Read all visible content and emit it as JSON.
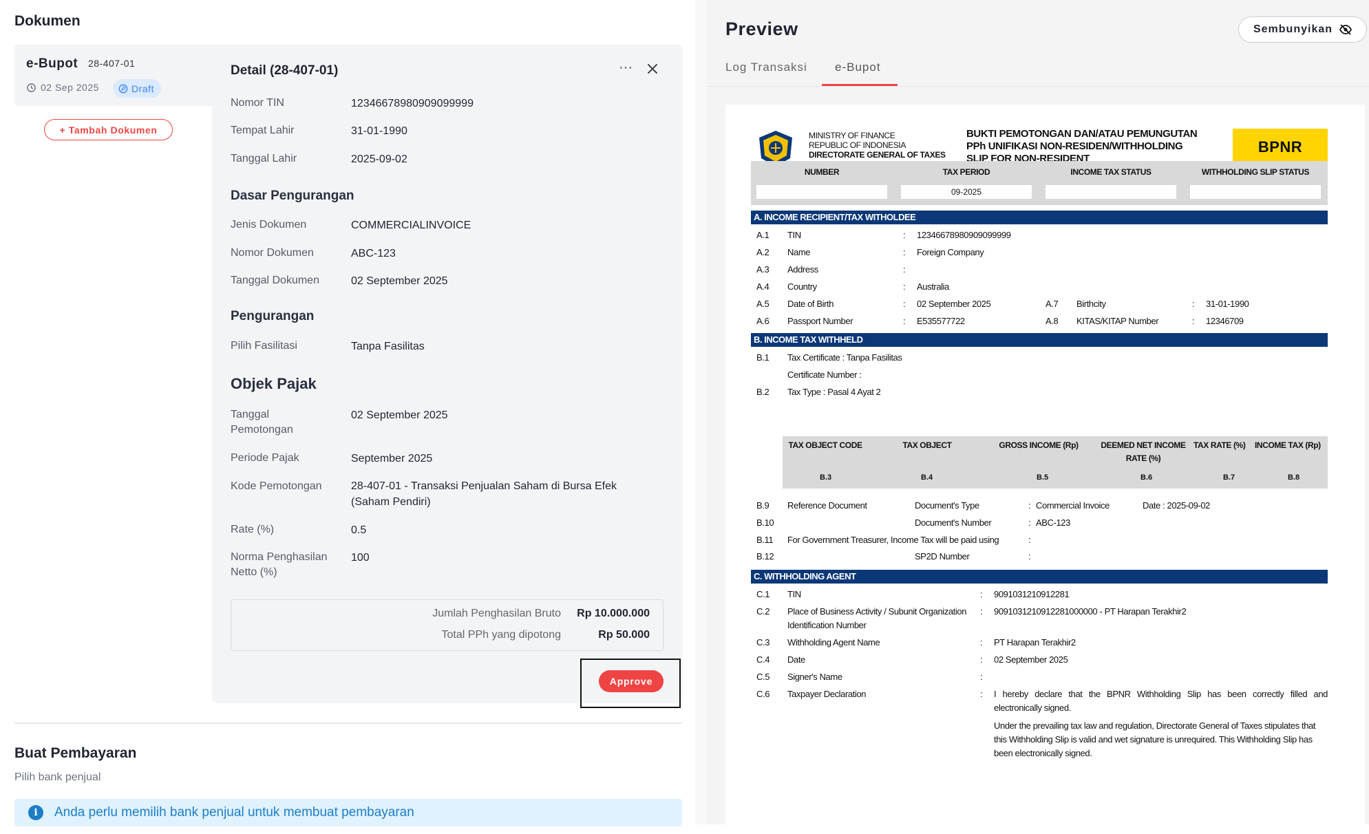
{
  "left": {
    "title": "Dokumen",
    "doc_card": {
      "title": "e-Bupot",
      "code": "28-407-01",
      "date": "02 Sep 2025",
      "status": "Draft"
    },
    "add_button": "+ Tambah Dokumen",
    "detail": {
      "title": "Detail (28-407-01)",
      "fields_top": [
        {
          "label": "Nomor TIN",
          "value": "12346678980909099999"
        },
        {
          "label": "Tempat Lahir",
          "value": "31-01-1990"
        },
        {
          "label": "Tanggal Lahir",
          "value": "2025-09-02"
        }
      ],
      "section_dasar": "Dasar Pengurangan",
      "fields_dasar": [
        {
          "label": "Jenis Dokumen",
          "value": "COMMERCIALINVOICE"
        },
        {
          "label": "Nomor Dokumen",
          "value": "ABC-123"
        },
        {
          "label": "Tanggal Dokumen",
          "value": "02 September 2025"
        }
      ],
      "section_pengurangan": "Pengurangan",
      "fields_pengurangan": [
        {
          "label": "Pilih Fasilitasi",
          "value": "Tanpa Fasilitas"
        }
      ],
      "section_objek": "Objek Pajak",
      "fields_objek": [
        {
          "label": "Tanggal Pemotongan",
          "value": "02 September 2025"
        },
        {
          "label": "Periode Pajak",
          "value": "September 2025"
        },
        {
          "label": "Kode Pemotongan",
          "value": "28-407-01 - Transaksi Penjualan Saham di Bursa Efek (Saham Pendiri)"
        },
        {
          "label": "Rate (%)",
          "value": "0.5"
        },
        {
          "label": "Norma Penghasilan Netto (%)",
          "value": "100"
        }
      ],
      "summary": [
        {
          "label": "Jumlah Penghasilan Bruto",
          "value": "Rp 10.000.000"
        },
        {
          "label": "Total PPh yang dipotong",
          "value": "Rp 50.000"
        }
      ],
      "approve": "Approve"
    },
    "payment": {
      "title": "Buat Pembayaran",
      "subtitle": "Pilih bank penjual",
      "info": "Anda perlu memilih bank penjual untuk membuat pembayaran"
    }
  },
  "preview": {
    "title": "Preview",
    "hide_button": "Sembunyikan",
    "tabs": [
      "Log Transaksi",
      "e-Bupot"
    ],
    "slip": {
      "ministry": [
        "MINISTRY OF FINANCE",
        "REPUBLIC OF INDONESIA",
        "DIRECTORATE GENERAL OF TAXES"
      ],
      "heading": [
        "BUKTI PEMOTONGAN DAN/ATAU PEMUNGUTAN",
        "PPh UNIFIKASI NON-RESIDEN/WITHHOLDING",
        "SLIP FOR NON-RESIDENT"
      ],
      "badge": "BPNR",
      "header_cols": [
        {
          "title": "NUMBER",
          "value": ""
        },
        {
          "title": "TAX PERIOD",
          "value": "09-2025"
        },
        {
          "title": "INCOME TAX STATUS",
          "value": ""
        },
        {
          "title": "WITHHOLDING SLIP STATUS",
          "value": ""
        }
      ],
      "section_a": "A. INCOME RECIPIENT/TAX WITHOLDEE",
      "a_rows": [
        {
          "code": "A.1",
          "label": "TIN",
          "value": "12346678980909099999"
        },
        {
          "code": "A.2",
          "label": "Name",
          "value": "Foreign Company"
        },
        {
          "code": "A.3",
          "label": "Address",
          "value": ""
        },
        {
          "code": "A.4",
          "label": "Country",
          "value": "Australia"
        },
        {
          "code": "A.5",
          "label": "Date of Birth",
          "value": "02 September 2025"
        },
        {
          "code": "A.6",
          "label": "Passport Number",
          "value": "E535577722"
        }
      ],
      "a_right": [
        {
          "code": "A.7",
          "label": "Birthcity",
          "value": "31-01-1990"
        },
        {
          "code": "A.8",
          "label": "KITAS/KITAP Number",
          "value": "12346709"
        }
      ],
      "section_b": "B. INCOME TAX WITHHELD",
      "b1": {
        "code": "B.1",
        "text": "Tax Certificate : Tanpa Fasilitas"
      },
      "b1_cert": "Certificate Number :",
      "b2": {
        "code": "B.2",
        "text": "Tax Type : Pasal 4 Ayat 2"
      },
      "object_cols": [
        {
          "title": "TAX OBJECT CODE",
          "sub": "B.3"
        },
        {
          "title": "TAX OBJECT",
          "sub": "B.4"
        },
        {
          "title": "GROSS INCOME (Rp)",
          "sub": "B.5"
        },
        {
          "title": "DEEMED NET INCOME RATE (%)",
          "sub": "B.6"
        },
        {
          "title": "TAX RATE (%)",
          "sub": "B.7"
        },
        {
          "title": "INCOME TAX (Rp)",
          "sub": "B.8"
        }
      ],
      "b9": {
        "code": "B.9",
        "label": "Reference Document",
        "sub": "Document's Type",
        "value": "Commercial Invoice",
        "date": "Date : 2025-09-02"
      },
      "b10": {
        "code": "B.10",
        "sub": "Document's Number",
        "value": "ABC-123"
      },
      "b11": {
        "code": "B.11",
        "label": "For Government Treasurer, Income Tax will be paid using"
      },
      "b12": {
        "code": "B.12",
        "sub": "SP2D Number"
      },
      "section_c": "C. WITHHOLDING AGENT",
      "c_rows": [
        {
          "code": "C.1",
          "label": "TIN",
          "value": "9091031210912281"
        },
        {
          "code": "C.2",
          "label": "Place of Business Activity / Subunit Organization",
          "label2": "Identification Number",
          "value": "9091031210912281000000 - PT Harapan Terakhir2"
        },
        {
          "code": "C.3",
          "label": "Withholding Agent Name",
          "value": "PT Harapan Terakhir2"
        },
        {
          "code": "C.4",
          "label": "Date",
          "value": "02 September 2025"
        },
        {
          "code": "C.5",
          "label": "Signer's Name",
          "value": ""
        },
        {
          "code": "C.6",
          "label": "Taxpayer Declaration",
          "value": ""
        }
      ],
      "declaration_1": [
        "I hereby declare that the BPNR Withholding Slip has been correctly filled and",
        "electronically signed."
      ],
      "declaration_2": [
        "Under the prevailing tax law and regulation, Directorate General of Taxes stipulates that",
        "this Withholding Slip is valid and wet signature is unrequired. This Withholding Slip has",
        "been electronically signed."
      ]
    }
  }
}
